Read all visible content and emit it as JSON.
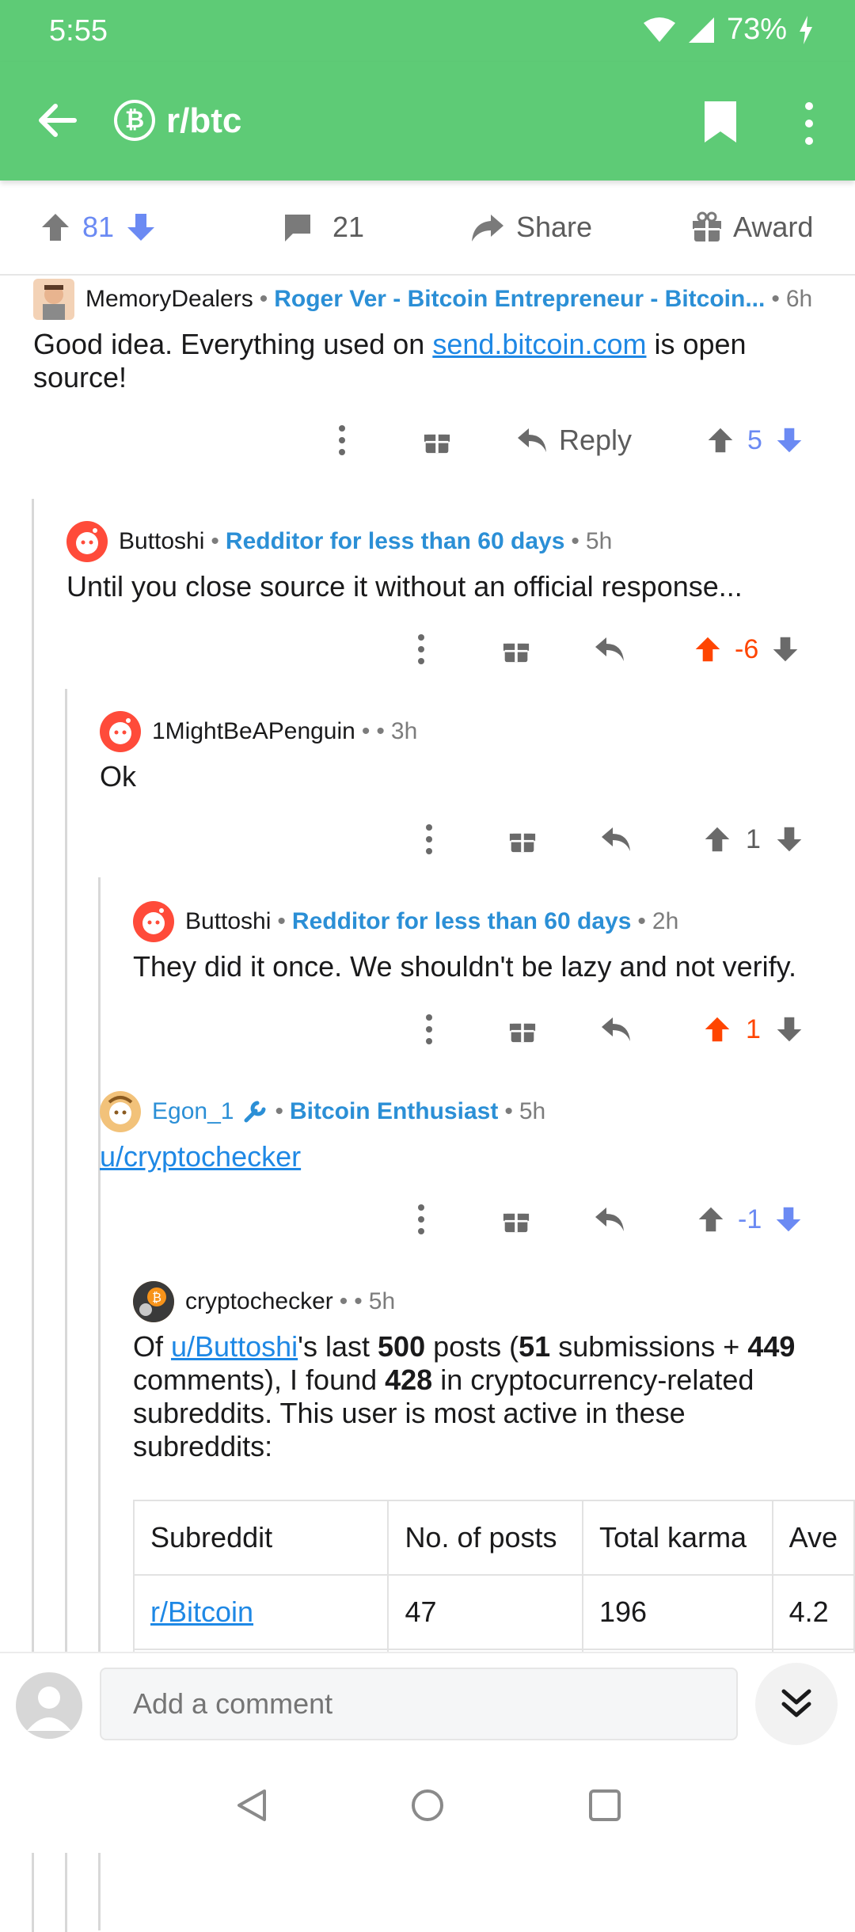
{
  "status": {
    "time": "5:55",
    "battery": "73%"
  },
  "toolbar": {
    "subreddit": "r/btc",
    "sub_icon_glyph": "₿"
  },
  "post_actions": {
    "upvotes": "81",
    "comments": "21",
    "share": "Share",
    "award": "Award"
  },
  "comments": [
    {
      "user": "MemoryDealers",
      "flair": "Roger Ver - Bitcoin Entrepreneur - Bitcoin...",
      "age": "6h",
      "text_before": "Good idea.  Everything used on ",
      "link": "send.bitcoin.com",
      "text_after": " is open source!",
      "reply_label": "Reply",
      "score": "5"
    },
    {
      "user": "Buttoshi",
      "flair": "Redditor for less than 60 days",
      "age": "5h",
      "text": "Until you close source it without an official response...",
      "score": "-6"
    },
    {
      "user": "1MightBeAPenguin",
      "flair": "",
      "age": "3h",
      "text": "Ok",
      "score": "1"
    },
    {
      "user": "Buttoshi",
      "flair": "Redditor for less than 60 days",
      "age": "2h",
      "text": "They did it once. We shouldn't be lazy and not verify.",
      "score": "1"
    },
    {
      "user": "Egon_1",
      "flair": "Bitcoin Enthusiast",
      "age": "5h",
      "link": "u/cryptochecker",
      "score": "-1"
    },
    {
      "user": "cryptochecker",
      "flair": "",
      "age": "5h",
      "p1": "Of ",
      "p_link": "u/Buttoshi",
      "p2": "'s last ",
      "n1": "500",
      "p3": " posts (",
      "n2": "51",
      "p4": " submissions + ",
      "n3": "449",
      "p5": " comments), I found ",
      "n4": "428",
      "p6": " in cryptocurrency-related subreddits. This user is most active in these subreddits:",
      "table": {
        "headers": [
          "Subreddit",
          "No. of posts",
          "Total karma",
          "Ave"
        ],
        "rows": [
          [
            "r/Bitcoin",
            "47",
            "196",
            "4.2"
          ]
        ]
      }
    }
  ],
  "composer": {
    "placeholder": "Add a comment"
  }
}
